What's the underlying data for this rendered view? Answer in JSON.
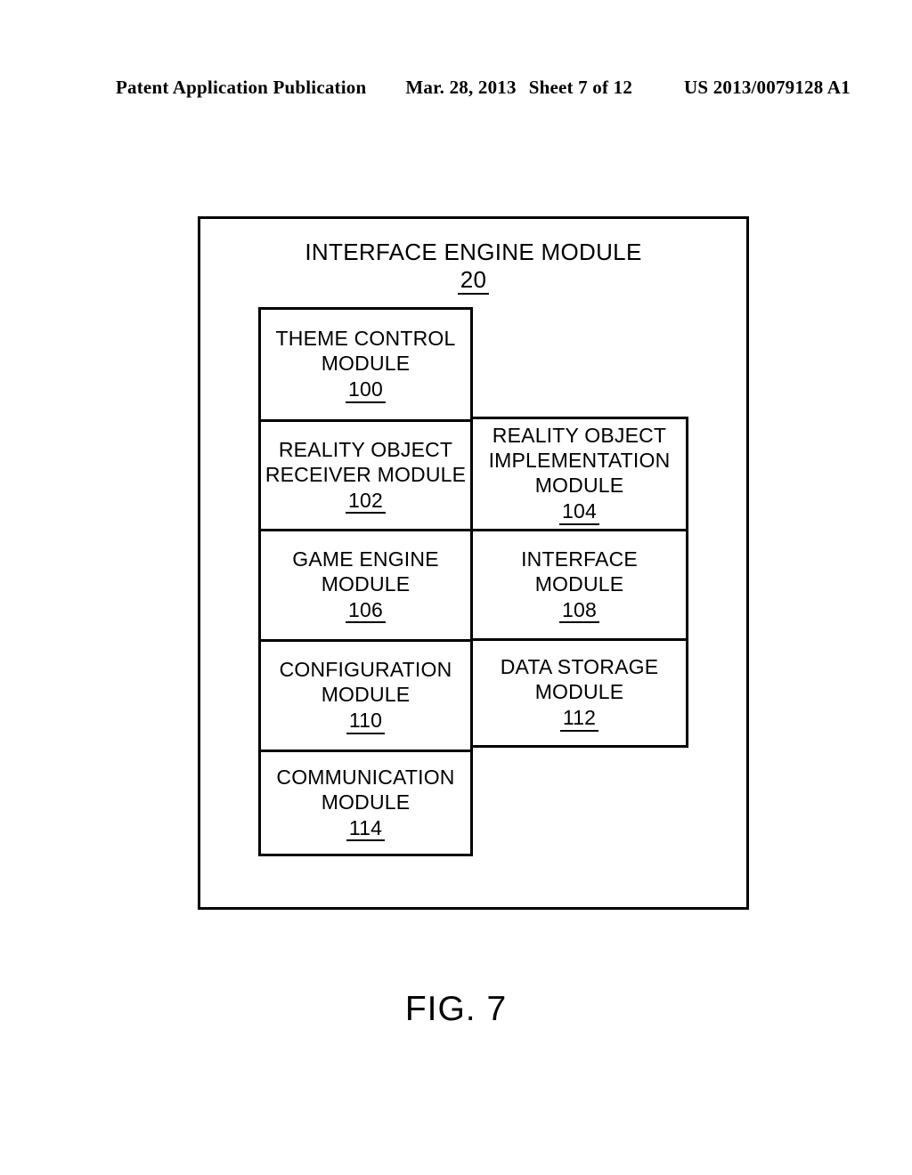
{
  "header": {
    "publication": "Patent Application Publication",
    "date": "Mar. 28, 2013",
    "sheet": "Sheet 7 of 12",
    "document_number": "US 2013/0079128 A1"
  },
  "figure": {
    "caption": "FIG. 7",
    "title": "INTERFACE ENGINE MODULE",
    "title_ref": "20",
    "left_column": [
      {
        "name": "THEME CONTROL\nMODULE",
        "ref": "100"
      },
      {
        "name": "REALITY OBJECT\nRECEIVER MODULE",
        "ref": "102"
      },
      {
        "name": "GAME ENGINE\nMODULE",
        "ref": "106"
      },
      {
        "name": "CONFIGURATION\nMODULE",
        "ref": "110"
      },
      {
        "name": "COMMUNICATION\nMODULE",
        "ref": "114"
      }
    ],
    "right_column": [
      {
        "name": "REALITY OBJECT\nIMPLEMENTATION\nMODULE",
        "ref": "104"
      },
      {
        "name": "INTERFACE\nMODULE",
        "ref": "108"
      },
      {
        "name": "DATA STORAGE\nMODULE",
        "ref": "112"
      }
    ]
  },
  "colors": {
    "ink": "#000000",
    "paper": "#ffffff"
  }
}
